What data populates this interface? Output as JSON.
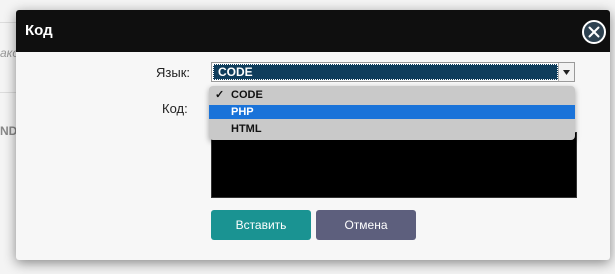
{
  "background": {
    "partial_text_1": "ако",
    "partial_text_2": "NDX"
  },
  "modal": {
    "title": "Код",
    "close_icon": "close-icon",
    "language_label": "Язык:",
    "code_label": "Код:",
    "language_select": {
      "selected_value": "CODE",
      "options": [
        {
          "label": "CODE",
          "checked": true,
          "highlighted": false
        },
        {
          "label": "PHP",
          "checked": false,
          "highlighted": true
        },
        {
          "label": "HTML",
          "checked": false,
          "highlighted": false
        }
      ]
    },
    "check_mark": "✓",
    "insert_button": "Вставить",
    "cancel_button": "Отмена"
  },
  "colors": {
    "header_bg": "#0f0f0f",
    "select_selected_bg": "#0f3d5c",
    "dropdown_highlight": "#1a73d9",
    "insert_button": "#1a9392",
    "cancel_button": "#5d5f7d"
  }
}
